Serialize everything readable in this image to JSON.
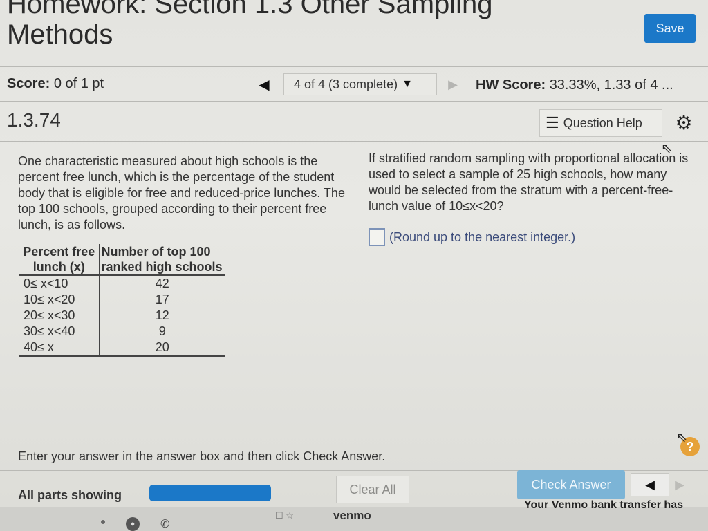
{
  "header": {
    "title_line1": "Homework: Section 1.3 Other Sampling",
    "title_line2": "Methods",
    "save_label": "Save"
  },
  "score_bar": {
    "score_label": "Score:",
    "score_value": "0 of 1 pt",
    "question_position": "4 of 4 (3 complete)",
    "hw_score_label": "HW Score:",
    "hw_score_value": "33.33%, 1.33 of 4 ..."
  },
  "question": {
    "number": "1.3.74",
    "help_label": "Question Help",
    "left_text": "One characteristic measured about high schools is the percent free lunch, which is  the percentage of the student body that is eligible for free and reduced-price lunches. The top 100 schools, grouped according to their percent free lunch, is as follows.",
    "right_text": "If stratified random sampling with proportional allocation is used to select a sample of 25 high schools, how many would be selected from the stratum with a percent-free-lunch value of 10≤x<20?",
    "answer_value": "",
    "answer_note": "(Round up to the nearest integer.)"
  },
  "table": {
    "header_col1_line1": "Percent free",
    "header_col1_line2": "lunch (x)",
    "header_col2_line1": "Number of top 100",
    "header_col2_line2": "ranked high schools",
    "rows": [
      {
        "range": "0≤  x<10",
        "count": "42"
      },
      {
        "range": "10≤  x<20",
        "count": "17"
      },
      {
        "range": "20≤  x<30",
        "count": "12"
      },
      {
        "range": "30≤  x<40",
        "count": "9"
      },
      {
        "range": "40≤  x",
        "count": "20"
      }
    ]
  },
  "footer": {
    "instruction": "Enter your answer in the answer box and then click Check Answer.",
    "help_symbol": "?",
    "parts_label": "All parts showing",
    "progress_fraction": 1.0,
    "clear_label": "Clear All",
    "check_label": "Check Answer"
  },
  "taskbar": {
    "venmo_label": "venmo",
    "notification": "Your Venmo bank transfer has"
  },
  "colors": {
    "accent": "#1b78c8",
    "check_button": "#7cb4d6",
    "help_badge": "#e6a23a"
  }
}
